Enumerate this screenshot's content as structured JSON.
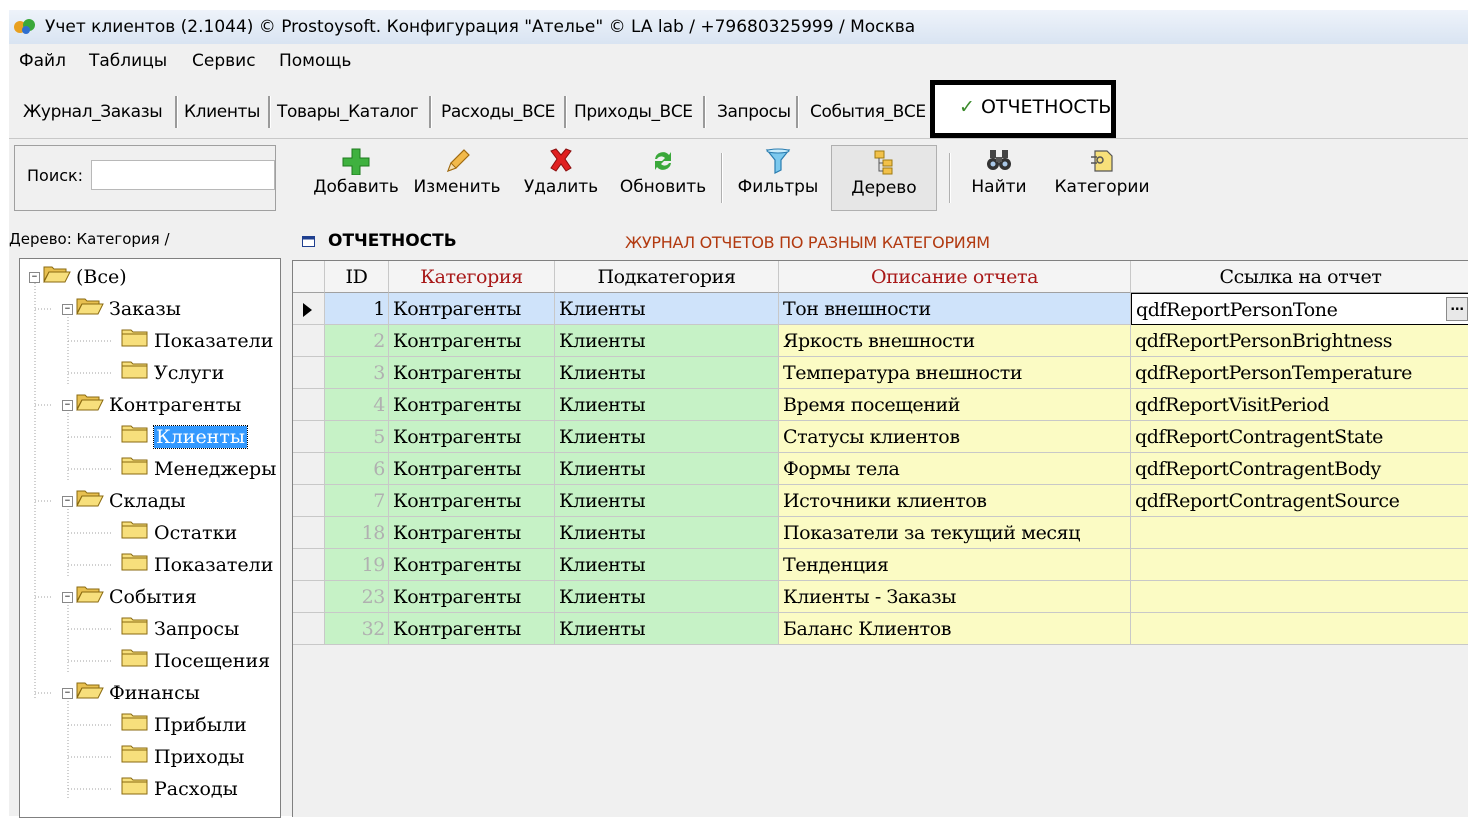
{
  "window": {
    "title": "Учет клиентов (2.1044) © Prostoysoft. Конфигурация \"Ателье\" © LA lab / +79680325999 / Москва"
  },
  "menu": [
    "Файл",
    "Таблицы",
    "Сервис",
    "Помощь"
  ],
  "tabs": [
    "Журнал_Заказы",
    "Клиенты",
    "Товары_Каталог",
    "Расходы_ВСЕ",
    "Приходы_ВСЕ",
    "Запросы",
    "События_ВСЕ"
  ],
  "active_tab": {
    "check": "✓",
    "label": "ОТЧЕТНОСТЬ"
  },
  "search": {
    "label": "Поиск:",
    "value": ""
  },
  "toolbar": {
    "add": "Добавить",
    "edit": "Изменить",
    "delete": "Удалить",
    "refresh": "Обновить",
    "filters": "Фильтры",
    "tree": "Дерево",
    "find": "Найти",
    "categories": "Категории"
  },
  "tree": {
    "header": "Дерево: Категория /",
    "nodes": [
      "(Все)",
      "Заказы",
      "Показатели",
      "Услуги",
      "Контрагенты",
      "Клиенты",
      "Менеджеры",
      "Склады",
      "Остатки",
      "Показатели",
      "События",
      "Запросы",
      "Посещения",
      "Финансы",
      "Прибыли",
      "Приходы",
      "Расходы"
    ],
    "selected": "Клиенты"
  },
  "grid": {
    "title": "ОТЧЕТНОСТЬ",
    "subtitle": "ЖУРНАЛ ОТЧЕТОВ ПО РАЗНЫМ КАТЕГОРИЯМ",
    "columns": [
      "ID",
      "Категория",
      "Подкатегория",
      "Описание отчета",
      "Ссылка на отчет"
    ],
    "rows": [
      {
        "id": "1",
        "category": "Контрагенты",
        "subcategory": "Клиенты",
        "description": "Тон внешности",
        "link": "qdfReportPersonTone"
      },
      {
        "id": "2",
        "category": "Контрагенты",
        "subcategory": "Клиенты",
        "description": "Яркость внешности",
        "link": "qdfReportPersonBrightness"
      },
      {
        "id": "3",
        "category": "Контрагенты",
        "subcategory": "Клиенты",
        "description": "Температура внешности",
        "link": "qdfReportPersonTemperature"
      },
      {
        "id": "4",
        "category": "Контрагенты",
        "subcategory": "Клиенты",
        "description": "Время посещений",
        "link": "qdfReportVisitPeriod"
      },
      {
        "id": "5",
        "category": "Контрагенты",
        "subcategory": "Клиенты",
        "description": "Статусы клиентов",
        "link": "qdfReportContragentState"
      },
      {
        "id": "6",
        "category": "Контрагенты",
        "subcategory": "Клиенты",
        "description": "Формы тела",
        "link": "qdfReportContragentBody"
      },
      {
        "id": "7",
        "category": "Контрагенты",
        "subcategory": "Клиенты",
        "description": "Источники клиентов",
        "link": "qdfReportContragentSource"
      },
      {
        "id": "18",
        "category": "Контрагенты",
        "subcategory": "Клиенты",
        "description": "Показатели за текущий месяц",
        "link": ""
      },
      {
        "id": "19",
        "category": "Контрагенты",
        "subcategory": "Клиенты",
        "description": "Тенденция",
        "link": ""
      },
      {
        "id": "23",
        "category": "Контрагенты",
        "subcategory": "Клиенты",
        "description": "Клиенты - Заказы",
        "link": ""
      },
      {
        "id": "32",
        "category": "Контрагенты",
        "subcategory": "Клиенты",
        "description": "Баланс Клиентов",
        "link": ""
      }
    ],
    "ellipsis": "..."
  },
  "colors": {
    "row_green": "#c6f2c6",
    "row_yellow": "#fbfbc4",
    "row_selected": "#cfe3fa",
    "header_red": "#a81818",
    "subtitle": "#b23a10"
  }
}
